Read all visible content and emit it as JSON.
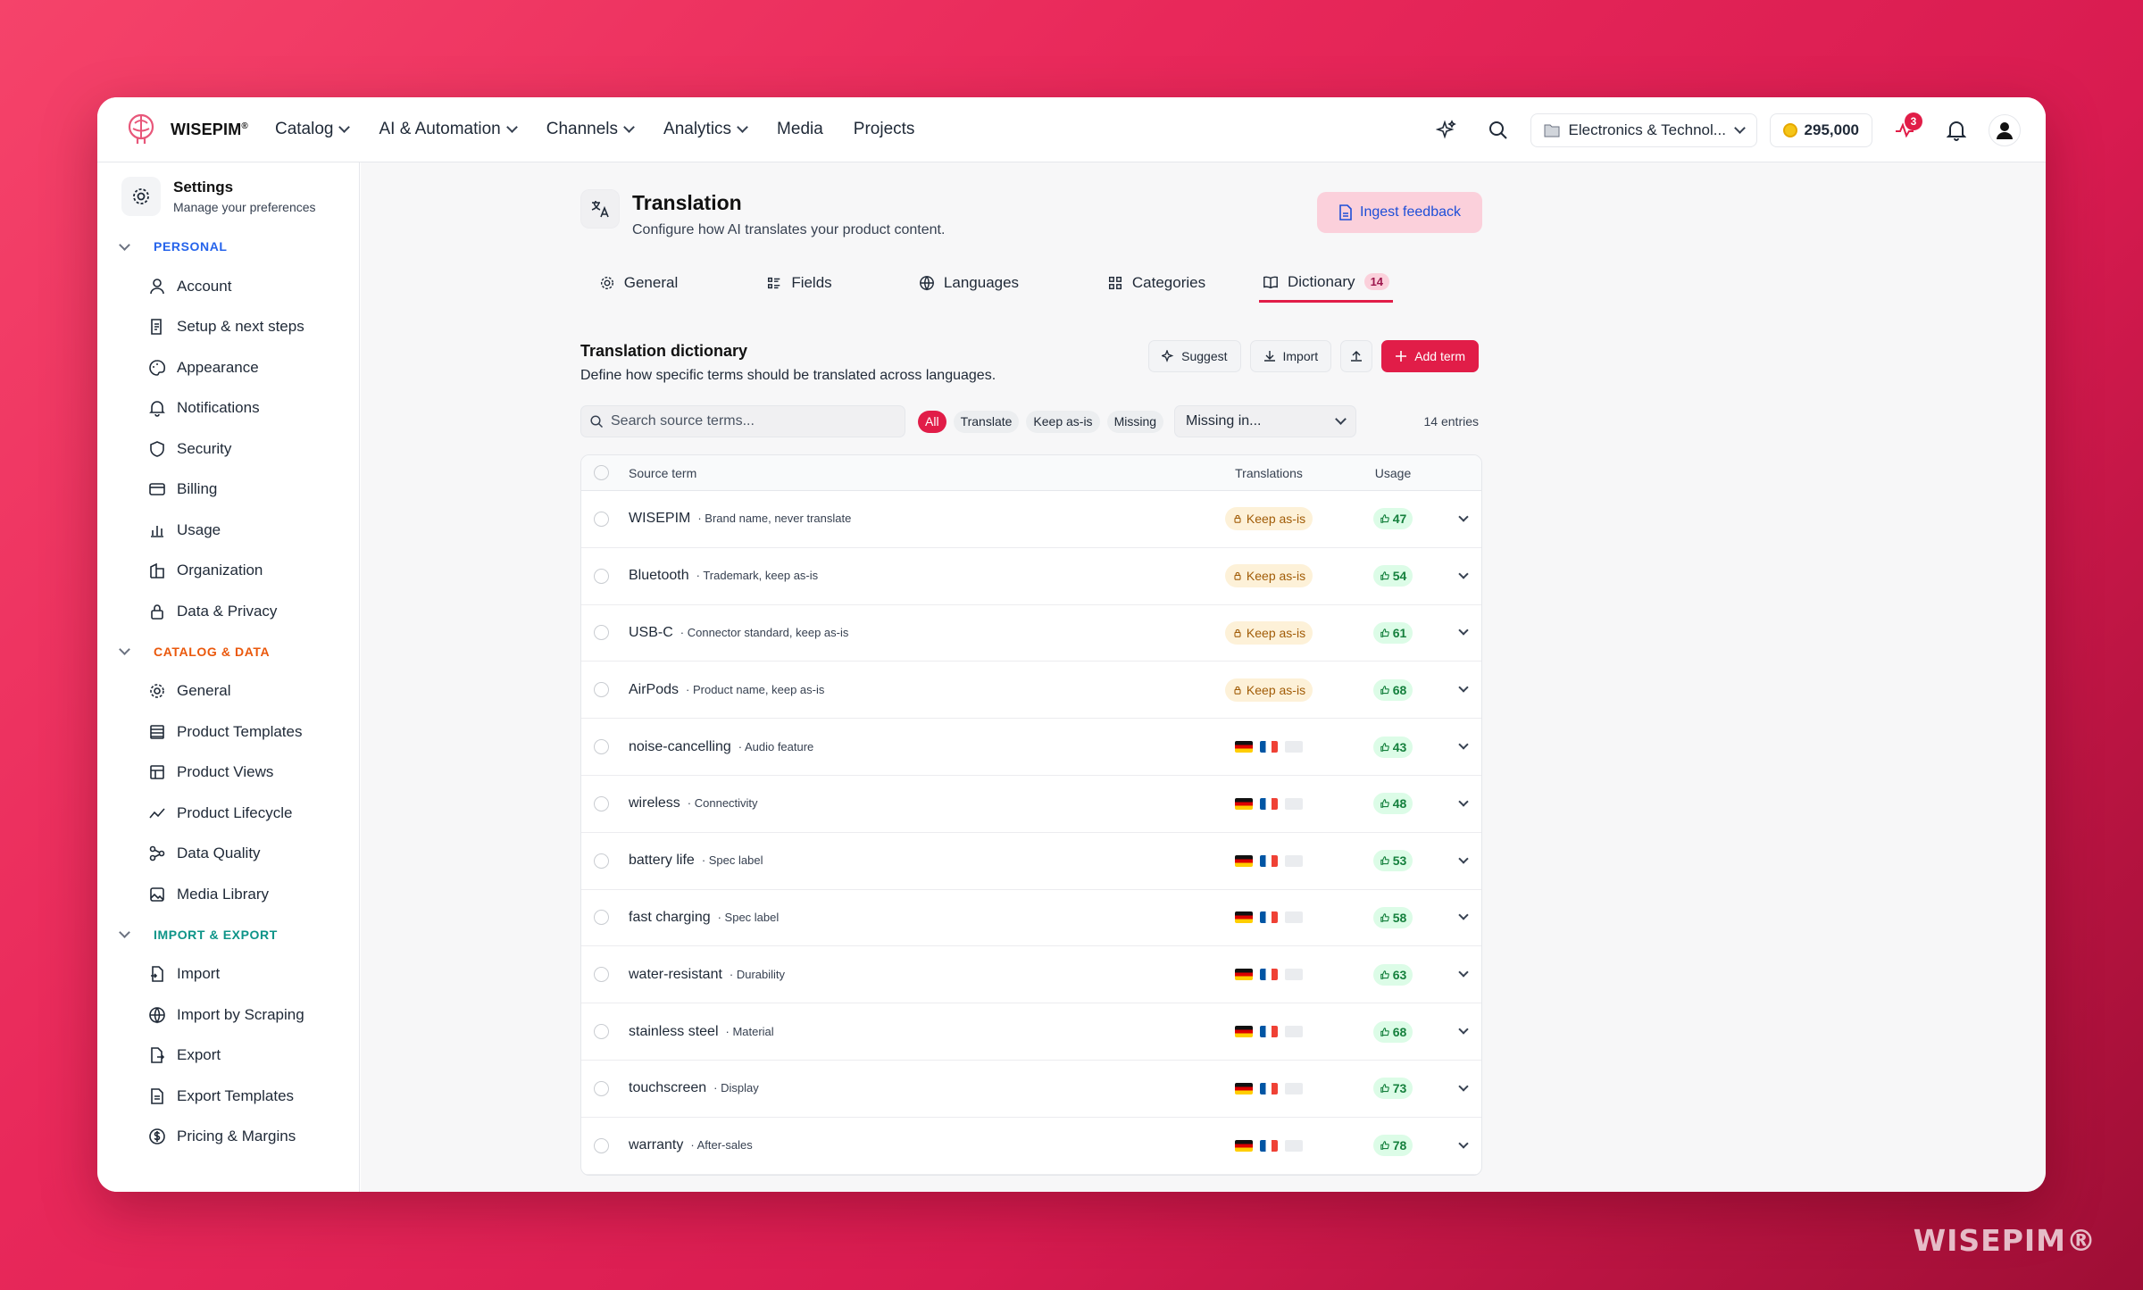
{
  "brand": {
    "name": "WISEPIM",
    "mark": "®",
    "watermark": "WISEPIM®"
  },
  "nav": [
    {
      "label": "Catalog",
      "dropdown": true
    },
    {
      "label": "AI & Automation",
      "dropdown": true
    },
    {
      "label": "Channels",
      "dropdown": true
    },
    {
      "label": "Analytics",
      "dropdown": true
    },
    {
      "label": "Media",
      "dropdown": false
    },
    {
      "label": "Projects",
      "dropdown": false
    }
  ],
  "topbar": {
    "org": "Electronics & Technol...",
    "credits": "295,000",
    "activity_count": "3"
  },
  "sidebar": {
    "title": "Settings",
    "subtitle": "Manage your preferences",
    "sections": [
      {
        "label": "PERSONAL",
        "color": "#2563eb",
        "items": [
          "Account",
          "Setup & next steps",
          "Appearance",
          "Notifications",
          "Security",
          "Billing",
          "Usage",
          "Organization",
          "Data & Privacy"
        ]
      },
      {
        "label": "CATALOG & DATA",
        "color": "#ea580c",
        "items": [
          "General",
          "Product Templates",
          "Product Views",
          "Product Lifecycle",
          "Data Quality",
          "Media Library"
        ]
      },
      {
        "label": "IMPORT & EXPORT",
        "color": "#0d9488",
        "items": [
          "Import",
          "Import by Scraping",
          "Export",
          "Export Templates",
          "Pricing & Margins"
        ]
      }
    ]
  },
  "page": {
    "title": "Translation",
    "subtitle": "Configure how AI translates your product content.",
    "ingest_label": "Ingest feedback"
  },
  "tabs": [
    {
      "label": "General",
      "icon": "gear-icon"
    },
    {
      "label": "Fields",
      "icon": "fields-icon"
    },
    {
      "label": "Languages",
      "icon": "globe-icon"
    },
    {
      "label": "Categories",
      "icon": "grid-icon"
    },
    {
      "label": "Dictionary",
      "icon": "book-icon",
      "count": "14",
      "active": true
    }
  ],
  "dictionary": {
    "title": "Translation dictionary",
    "subtitle": "Define how specific terms should be translated across languages.",
    "actions": {
      "suggest": "Suggest",
      "import": "Import",
      "add": "Add term"
    },
    "search_placeholder": "Search source terms...",
    "filters": [
      "All",
      "Translate",
      "Keep as-is",
      "Missing"
    ],
    "missing_select": "Missing in...",
    "entries": "14 entries",
    "columns": {
      "source": "Source term",
      "translations": "Translations",
      "usage": "Usage"
    },
    "keep_label": "Keep as-is",
    "rows": [
      {
        "term": "WISEPIM",
        "note": "· Brand name, never translate",
        "keep": true,
        "usage": "47"
      },
      {
        "term": "Bluetooth",
        "note": "· Trademark, keep as-is",
        "keep": true,
        "usage": "54"
      },
      {
        "term": "USB-C",
        "note": "· Connector standard, keep as-is",
        "keep": true,
        "usage": "61"
      },
      {
        "term": "AirPods",
        "note": "· Product name, keep as-is",
        "keep": true,
        "usage": "68"
      },
      {
        "term": "noise-cancelling",
        "note": "· Audio feature",
        "keep": false,
        "usage": "43"
      },
      {
        "term": "wireless",
        "note": "· Connectivity",
        "keep": false,
        "usage": "48"
      },
      {
        "term": "battery life",
        "note": "· Spec label",
        "keep": false,
        "usage": "53"
      },
      {
        "term": "fast charging",
        "note": "· Spec label",
        "keep": false,
        "usage": "58"
      },
      {
        "term": "water-resistant",
        "note": "· Durability",
        "keep": false,
        "usage": "63"
      },
      {
        "term": "stainless steel",
        "note": "· Material",
        "keep": false,
        "usage": "68"
      },
      {
        "term": "touchscreen",
        "note": "· Display",
        "keep": false,
        "usage": "73"
      },
      {
        "term": "warranty",
        "note": "· After-sales",
        "keep": false,
        "usage": "78"
      }
    ],
    "flags": [
      "de",
      "fr",
      "gb"
    ]
  },
  "colors": {
    "accent": "#e11d48",
    "keep_bg": "#fdf1d8",
    "usage_bg": "#dcfce7"
  }
}
